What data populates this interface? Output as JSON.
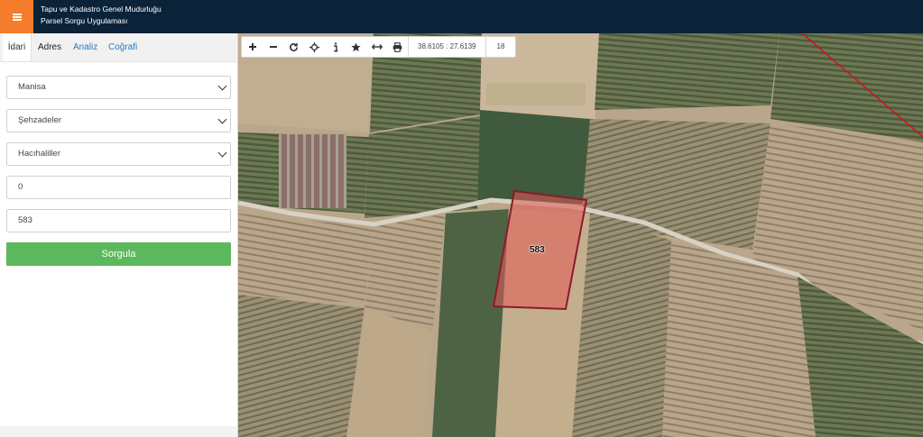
{
  "header": {
    "org_title": "Tapu ve Kadastro Genel Mudurluğu",
    "app_title": "Parsel Sorgu Uygulaması",
    "accent_color": "#f47c2a",
    "bg_color": "#0b2339"
  },
  "tabs": [
    {
      "label": "İdari"
    },
    {
      "label": "Adres"
    },
    {
      "label": "Analiz"
    },
    {
      "label": "Coğrafi"
    }
  ],
  "form": {
    "province": "Manisa",
    "district": "Şehzadeler",
    "neighborhood": "Hacıhaliller",
    "block": "0",
    "parcel": "583",
    "submit_label": "Sorgula",
    "submit_color": "#5cb85c"
  },
  "toolbar": {
    "tools": [
      "zoom-in-icon",
      "zoom-out-icon",
      "refresh-icon",
      "locate-icon",
      "info-icon",
      "favorite-icon",
      "measure-icon",
      "print-icon"
    ],
    "coordinates": "38.6105 : 27.6139",
    "zoom_level": "18"
  },
  "map": {
    "parcel_label": "583",
    "parcel_color": "#8b1a2b",
    "boundary_color": "#d0131a"
  }
}
